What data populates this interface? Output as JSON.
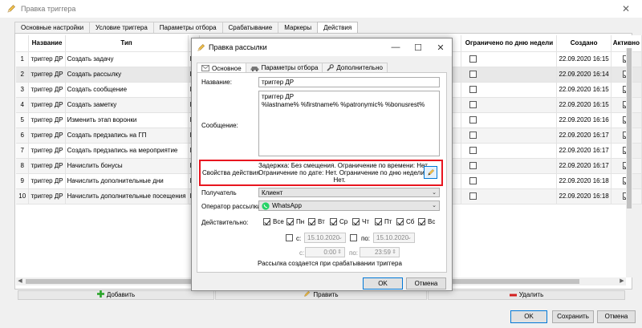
{
  "window": {
    "title": "Правка триггера",
    "tabs": [
      "Основные настройки",
      "Условие триггера",
      "Параметры отбора",
      "Срабатывание",
      "Маркеры",
      "Действия"
    ],
    "active_tab": 5
  },
  "table": {
    "headers": [
      "",
      "Название",
      "Тип",
      "",
      "",
      "Ограничено по дню недели",
      "Создано",
      "Активно"
    ],
    "rows": [
      {
        "n": "1",
        "name": "триггер ДР",
        "type": "Создать задачу",
        "tail": "Бе",
        "d": false,
        "created": "22.09.2020 16:15",
        "active": true
      },
      {
        "n": "2",
        "name": "триггер ДР",
        "type": "Создать рассылку",
        "tail": "Бе",
        "d": false,
        "created": "22.09.2020 16:14",
        "active": true
      },
      {
        "n": "3",
        "name": "триггер ДР",
        "type": "Создать сообщение",
        "tail": "Бе",
        "d": false,
        "created": "22.09.2020 16:15",
        "active": true
      },
      {
        "n": "4",
        "name": "триггер ДР",
        "type": "Создать заметку",
        "tail": "Бе",
        "d": false,
        "created": "22.09.2020 16:15",
        "active": true
      },
      {
        "n": "5",
        "name": "триггер ДР",
        "type": "Изменить этап воронки",
        "tail": "Бе",
        "d": false,
        "created": "22.09.2020 16:16",
        "active": true
      },
      {
        "n": "6",
        "name": "триггер ДР",
        "type": "Создать предзапись на ГП",
        "tail": "Бе",
        "d": false,
        "created": "22.09.2020 16:17",
        "active": true
      },
      {
        "n": "7",
        "name": "триггер ДР",
        "type": "Создать предзапись на мероприятие",
        "tail": "Бе",
        "d": false,
        "created": "22.09.2020 16:17",
        "active": true
      },
      {
        "n": "8",
        "name": "триггер ДР",
        "type": "Начислить бонусы",
        "tail": "Бе",
        "d": false,
        "created": "22.09.2020 16:17",
        "active": true
      },
      {
        "n": "9",
        "name": "триггер ДР",
        "type": "Начислить дополнительные дни",
        "tail": "Бе",
        "d": false,
        "created": "22.09.2020 16:18",
        "active": true
      },
      {
        "n": "10",
        "name": "триггер ДР",
        "type": "Начислить дополнительные посещения",
        "tail": "Бе",
        "d": false,
        "created": "22.09.2020 16:18",
        "active": true
      }
    ]
  },
  "bottom": {
    "add": "Добавить",
    "edit": "Править",
    "delete": "Удалить"
  },
  "buttons": {
    "ok": "OK",
    "save": "Сохранить",
    "cancel": "Отмена"
  },
  "dialog": {
    "title": "Правка рассылки",
    "tabs": [
      "Основное",
      "Параметры отбора",
      "Дополнительно"
    ],
    "name_label": "Название:",
    "name_value": "триггер ДР",
    "message_label": "Сообщение:",
    "message_lines": [
      "триггер ДР",
      "%lastname% %firstname% %patronymic% %bonusrest%"
    ],
    "props_label": "Свойства действия",
    "props_lines": [
      "Задержка: Без смещения. Ограничение по времени: Нет.",
      "Ограничение по дате: Нет. Ограничение по дню недели:",
      "Нет."
    ],
    "recipient_label": "Получатель",
    "recipient_value": "Клиент",
    "operator_label": "Оператор рассылки:",
    "operator_value": "WhatsApp",
    "valid_label": "Действительно:",
    "days": [
      "Все",
      "Пн",
      "Вт",
      "Ср",
      "Чт",
      "Пт",
      "Сб",
      "Вс"
    ],
    "from_label": "с:",
    "from_date": "15.10.2020",
    "to_label": "по:",
    "to_date": "15.10.2020",
    "time_from_label": "с:",
    "time_from": "0:00",
    "time_to_label": "по:",
    "time_to": "23:59",
    "note": "Рассылка создается при срабатывании триггера",
    "ok": "OK",
    "cancel": "Отмена"
  },
  "colors": {
    "highlight": "#e8151f",
    "accent": "#0078d7",
    "whatsapp": "#25d366"
  }
}
